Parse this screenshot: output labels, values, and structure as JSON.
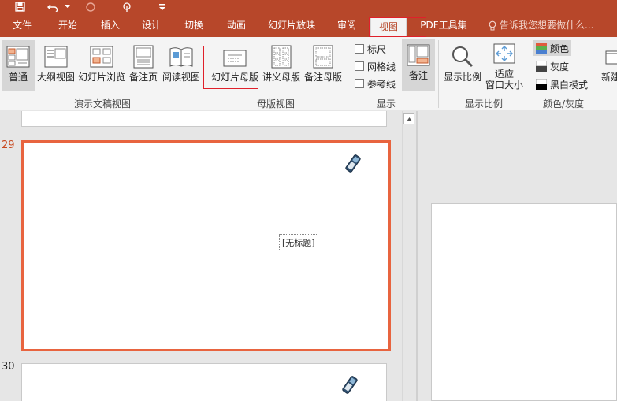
{
  "colors": {
    "accent": "#b7472a",
    "selection": "#e8643f",
    "highlight_box": "#e0202a"
  },
  "qat": {
    "icons": [
      "save-icon",
      "undo-icon",
      "undo-dropdown-icon",
      "redo-icon",
      "touch-mode-icon",
      "customize-icon"
    ]
  },
  "tabs": [
    {
      "label": "文件",
      "active": false
    },
    {
      "label": "开始",
      "active": false
    },
    {
      "label": "插入",
      "active": false
    },
    {
      "label": "设计",
      "active": false
    },
    {
      "label": "切换",
      "active": false
    },
    {
      "label": "动画",
      "active": false
    },
    {
      "label": "幻灯片放映",
      "active": false
    },
    {
      "label": "审阅",
      "active": false
    },
    {
      "label": "视图",
      "active": true
    },
    {
      "label": "PDF工具集",
      "active": false
    }
  ],
  "tellme": {
    "placeholder": "告诉我您想要做什么...",
    "icon": "lightbulb-icon"
  },
  "ribbon": {
    "presentation_views": {
      "label": "演示文稿视图",
      "buttons": [
        {
          "label": "普通",
          "icon": "normal-view-icon",
          "pressed": true
        },
        {
          "label": "大纲视图",
          "icon": "outline-view-icon",
          "pressed": false
        },
        {
          "label": "幻灯片浏览",
          "icon": "slide-sorter-icon",
          "pressed": false
        },
        {
          "label": "备注页",
          "icon": "notes-page-icon",
          "pressed": false
        },
        {
          "label": "阅读视图",
          "icon": "reading-view-icon",
          "pressed": false
        }
      ]
    },
    "master_views": {
      "label": "母版视图",
      "buttons": [
        {
          "label": "幻灯片母版",
          "icon": "slide-master-icon"
        },
        {
          "label": "讲义母版",
          "icon": "handout-master-icon"
        },
        {
          "label": "备注母版",
          "icon": "notes-master-icon"
        }
      ]
    },
    "show": {
      "label": "显示",
      "checkboxes": [
        {
          "label": "标尺",
          "checked": false
        },
        {
          "label": "网格线",
          "checked": false
        },
        {
          "label": "参考线",
          "checked": false
        }
      ],
      "notes_button": {
        "label": "备注",
        "icon": "notes-icon",
        "pressed": true
      }
    },
    "zoom": {
      "label": "显示比例",
      "buttons": [
        {
          "label": "显示比例",
          "icon": "zoom-icon"
        },
        {
          "label": "适应\n窗口大小",
          "line1": "适应",
          "line2": "窗口大小",
          "icon": "fit-window-icon"
        }
      ]
    },
    "color_grayscale": {
      "label": "颜色/灰度",
      "options": [
        {
          "label": "颜色",
          "selected": true
        },
        {
          "label": "灰度",
          "selected": false
        },
        {
          "label": "黑白模式",
          "selected": false
        }
      ]
    },
    "window": {
      "new_window_label": "新建"
    }
  },
  "slides": [
    {
      "number": "29",
      "selected": true,
      "placeholder": "[无标题]"
    },
    {
      "number": "30",
      "selected": false
    }
  ]
}
